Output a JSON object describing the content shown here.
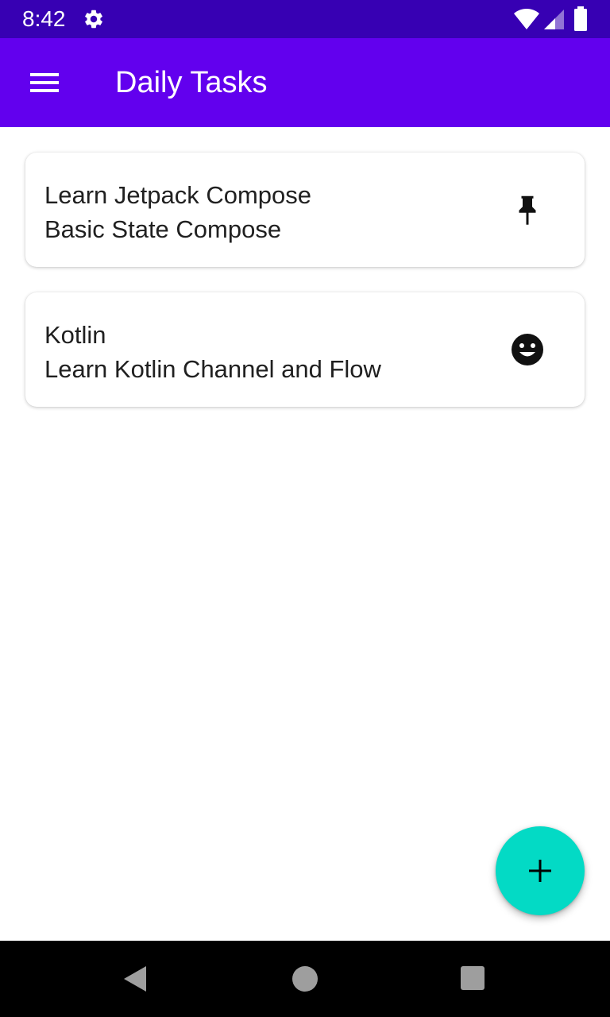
{
  "status_bar": {
    "time": "8:42",
    "icons": [
      "settings-gear-icon",
      "wifi-icon",
      "cell-signal-icon",
      "battery-icon"
    ],
    "color": "#3700b3"
  },
  "app_bar": {
    "menu_icon": "hamburger-menu-icon",
    "title": "Daily Tasks",
    "color": "#6200ee"
  },
  "tasks": [
    {
      "title": "Learn Jetpack Compose",
      "subtitle": "Basic State Compose",
      "icon": "pushpin-icon"
    },
    {
      "title": "Kotlin",
      "subtitle": "Learn Kotlin Channel and Flow",
      "icon": "smiley-face-icon"
    }
  ],
  "fab": {
    "icon": "add-icon",
    "color": "#03dac5"
  },
  "navigation_bar": {
    "buttons": [
      "back-icon",
      "home-icon",
      "recents-icon"
    ]
  }
}
